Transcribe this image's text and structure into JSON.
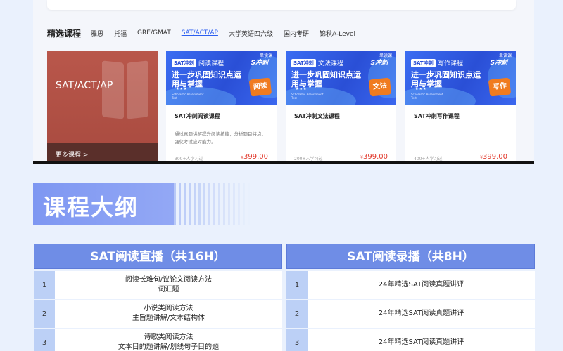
{
  "nav": {
    "title": "精选课程",
    "tabs": [
      {
        "label": "雅思",
        "active": false
      },
      {
        "label": "托福",
        "active": false
      },
      {
        "label": "GRE/GMAT",
        "active": false
      },
      {
        "label": "SAT/ACT/AP",
        "active": true
      },
      {
        "label": "大学英语四六级",
        "active": false
      },
      {
        "label": "国内考研",
        "active": false
      },
      {
        "label": "锦秋A-Level",
        "active": false
      }
    ]
  },
  "promo": {
    "title": "SAT/ACT/AP",
    "more": "更多课程 >"
  },
  "cards": [
    {
      "chip": "SAT冲刺",
      "banner_title": "阅读课程",
      "headline": "进一步巩固知识点运用与掌握",
      "sub": "Scholastic Assessment Test",
      "stars": "★★★",
      "seal": "阅读",
      "badge": "单读课",
      "logo": "S冲刺",
      "name": "SAT冲刺阅读课程",
      "desc": "通过真题讲解提升阅读技能，分析题目特点，强化考试应对能力。",
      "count": "300+人学习过",
      "currency": "¥",
      "price": "399.00"
    },
    {
      "chip": "SAT冲刺",
      "banner_title": "文法课程",
      "headline": "进一步巩固知识点运用与掌握",
      "sub": "Scholastic Assessment Test",
      "stars": "★★★",
      "seal": "文法",
      "badge": "单读课",
      "logo": "S冲刺",
      "name": "SAT冲刺文法课程",
      "desc": "",
      "count": "200+人学习过",
      "currency": "¥",
      "price": "399.00"
    },
    {
      "chip": "SAT冲刺",
      "banner_title": "写作课程",
      "headline": "进一步巩固知识点运用与掌握",
      "sub": "Scholastic Assessment Test",
      "stars": "★★★",
      "seal": "写作",
      "badge": "单读课",
      "logo": "S冲刺",
      "name": "SAT冲刺写作课程",
      "desc": "",
      "count": "400+人学习过",
      "currency": "¥",
      "price": "399.00"
    }
  ],
  "section": {
    "title": "课程大纲"
  },
  "outline": {
    "left": {
      "header": "SAT阅读直播（共16H）",
      "rows": [
        {
          "num": "1",
          "lines": [
            "阅读长难句/议论文阅读方法",
            "词汇题"
          ]
        },
        {
          "num": "2",
          "lines": [
            "小说类阅读方法",
            "主旨题讲解/文本结构体"
          ]
        },
        {
          "num": "3",
          "lines": [
            "诗歌类阅读方法",
            "文本目的题讲解/划线句子目的题"
          ]
        }
      ]
    },
    "right": {
      "header": "SAT阅读录播（共8H）",
      "rows": [
        {
          "num": "1",
          "lines": [
            "24年精选SAT阅读真题讲评"
          ]
        },
        {
          "num": "2",
          "lines": [
            "24年精选SAT阅读真题讲评"
          ]
        },
        {
          "num": "3",
          "lines": [
            "24年精选SAT阅读真题讲评"
          ]
        }
      ]
    }
  },
  "colors": {
    "accent": "#2c5ff0",
    "table_header": "#6f8de6",
    "price": "#e23b2e",
    "promo": "#b9574b"
  }
}
